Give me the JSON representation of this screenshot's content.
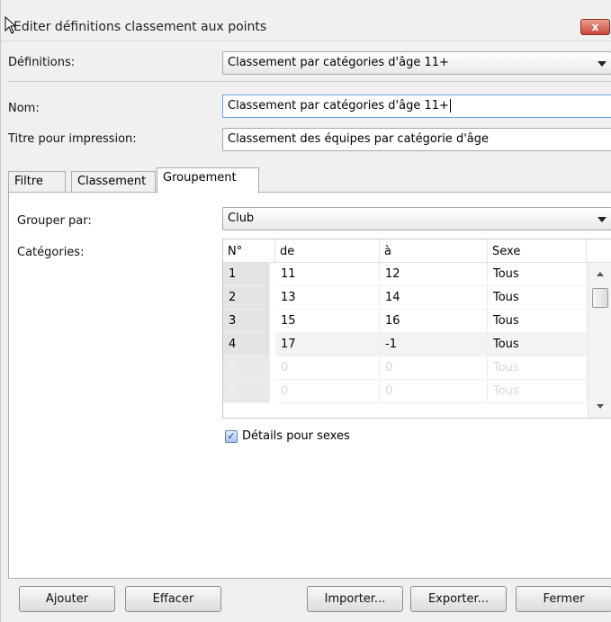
{
  "window": {
    "title": "Editer définitions classement aux points",
    "close_glyph": "x"
  },
  "definitions": {
    "label": "Définitions:",
    "selected": "Classement par catégories d'âge 11+"
  },
  "name": {
    "label": "Nom:",
    "value": "Classement par catégories d'âge 11+"
  },
  "print_title": {
    "label": "Titre pour impression:",
    "value": "Classement des équipes par catégorie d'âge"
  },
  "tabs": [
    {
      "label": "Filtre",
      "active": false
    },
    {
      "label": "Classement",
      "active": false
    },
    {
      "label": "Groupement",
      "active": true
    }
  ],
  "group_by": {
    "label": "Grouper par:",
    "selected": "Club"
  },
  "categories": {
    "label": "Catégories:",
    "columns": [
      "N°",
      "de",
      "à",
      "Sexe"
    ],
    "rows": [
      [
        "1",
        "11",
        "12",
        "Tous"
      ],
      [
        "2",
        "13",
        "14",
        "Tous"
      ],
      [
        "3",
        "15",
        "16",
        "Tous"
      ],
      [
        "4",
        "17",
        "-1",
        "Tous"
      ],
      [
        "5",
        "0",
        "0",
        "Tous"
      ],
      [
        "6",
        "0",
        "0",
        "Tous"
      ]
    ]
  },
  "sex_details": {
    "label": "Détails pour sexes",
    "checked": true
  },
  "buttons": {
    "add": "Ajouter",
    "delete": "Effacer",
    "import": "Importer...",
    "export": "Exporter...",
    "close": "Fermer"
  },
  "icons": {
    "close": "close-icon",
    "dropdown": "chevron-down-icon",
    "check": "checkmark-icon",
    "cursor": "mouse-pointer-icon"
  },
  "colors": {
    "close_button": "#c9473a",
    "focus_border": "#6ea0d8",
    "row_number_bg": "#e3e3e3",
    "checkbox": "#a9c4ee"
  }
}
